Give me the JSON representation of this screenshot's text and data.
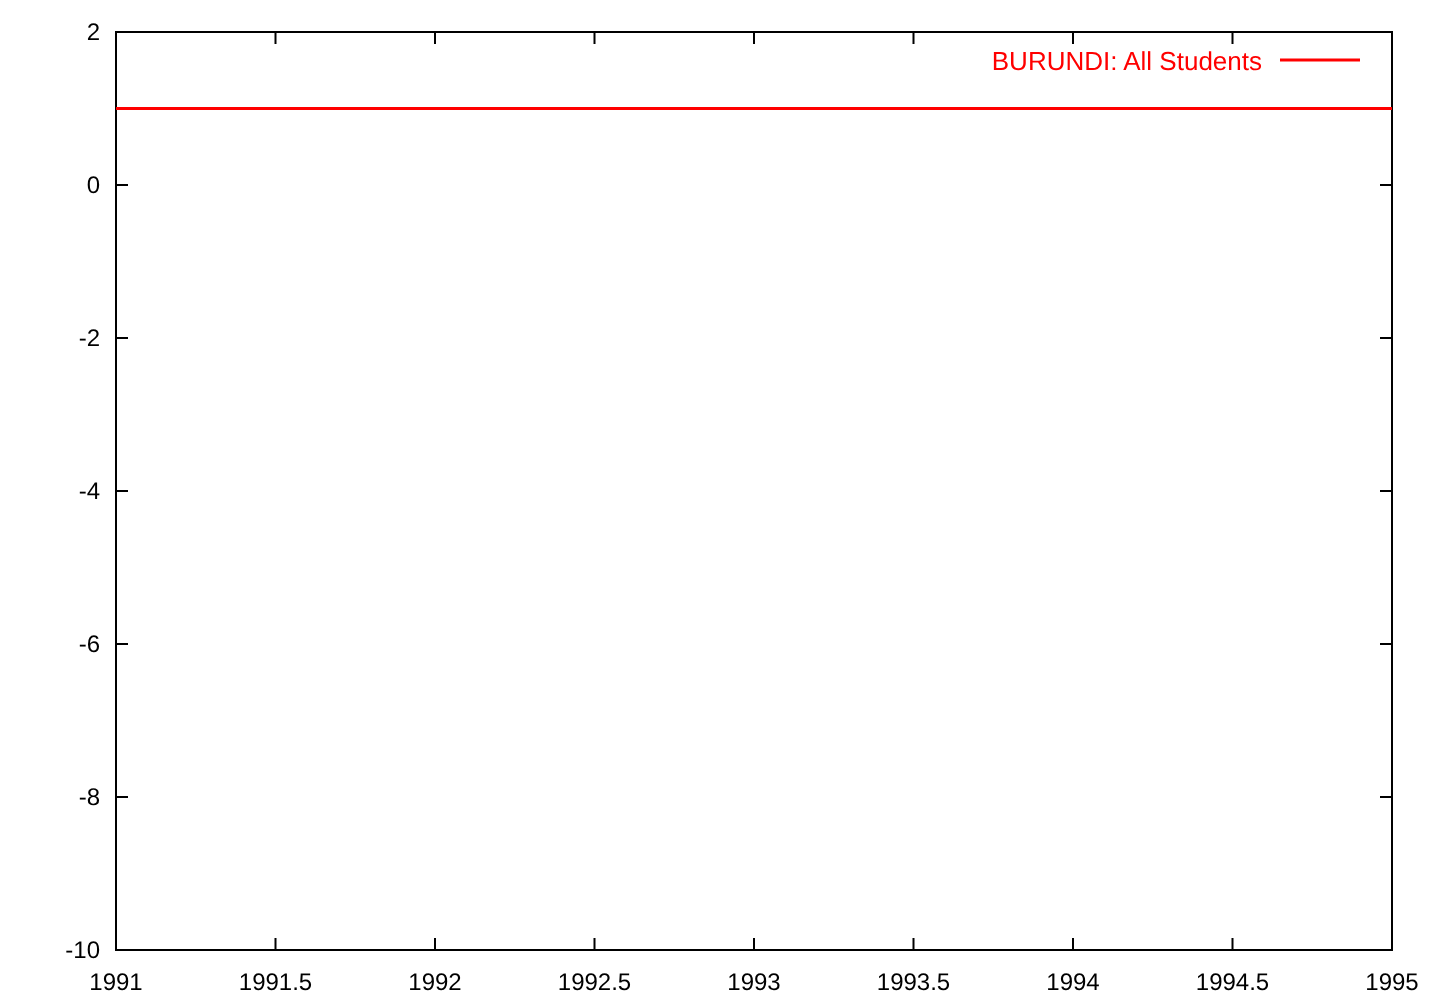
{
  "chart": {
    "chart_data": {
      "type": "line",
      "x": [
        1991,
        1995
      ],
      "series": [
        {
          "name": "BURUNDI: All Students",
          "color": "#ff0000",
          "values": [
            1,
            1
          ]
        }
      ],
      "xlim": [
        1991,
        1995
      ],
      "ylim": [
        -10,
        2
      ],
      "xticks": [
        1991,
        1991.5,
        1992,
        1992.5,
        1993,
        1993.5,
        1994,
        1994.5,
        1995
      ],
      "yticks": [
        -10,
        -8,
        -6,
        -4,
        -2,
        0,
        2
      ]
    }
  }
}
